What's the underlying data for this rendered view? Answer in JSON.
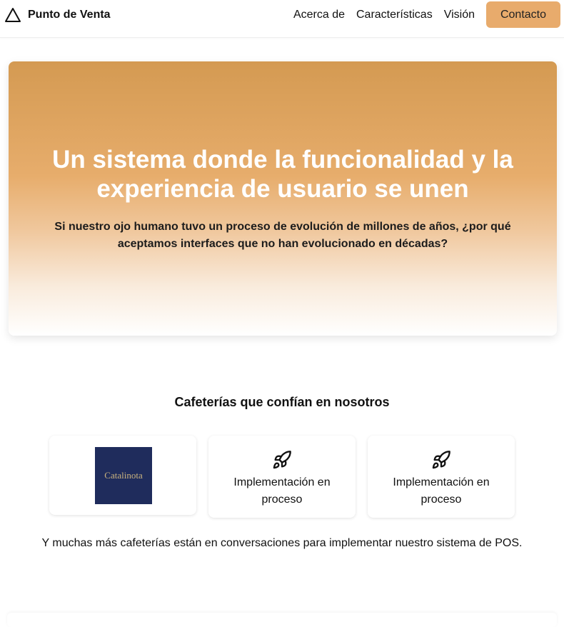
{
  "header": {
    "brand": {
      "icon": "triangle-logo-icon",
      "name": "Punto de Venta"
    },
    "nav": [
      "Acerca de",
      "Características",
      "Visión"
    ],
    "cta_label": "Contacto",
    "cta_color": "#e8ab6c"
  },
  "hero": {
    "title": "Un sistema donde la funcionalidad y la experiencia de usuario se unen",
    "subtitle": "Si nuestro ojo humano tuvo un proceso de evolución de millones de años, ¿por qué aceptamos interfaces que no han evolucionado en décadas?",
    "gradient_top": "#d49a52",
    "gradient_bottom": "#ffffff"
  },
  "trust": {
    "title": "Cafeterías que confían en nosotros",
    "cards": [
      {
        "type": "logo",
        "logo_text": "Catalinota",
        "logo_bg": "#1f2c5c"
      },
      {
        "type": "pending",
        "icon": "rocket-icon",
        "label": "Implementación en proceso"
      },
      {
        "type": "pending",
        "icon": "rocket-icon",
        "label": "Implementación en proceso"
      }
    ],
    "footnote": "Y muchas más cafeterías están en conversaciones para implementar nuestro sistema de POS."
  }
}
